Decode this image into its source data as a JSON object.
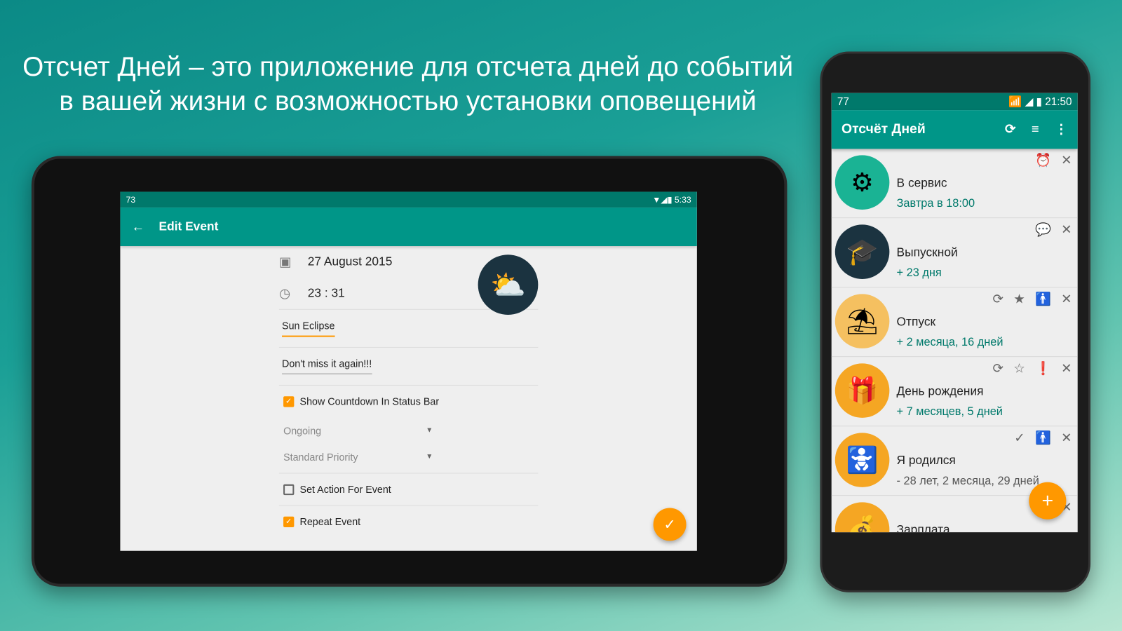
{
  "headline": [
    "Отсчет Дней – это приложение для отсчета дней до событий",
    "в вашей жизни с возможностью установки оповещений"
  ],
  "tablet": {
    "status": {
      "notif": "73",
      "time": "5:33"
    },
    "toolbar": {
      "title": "Edit Event",
      "back_icon": "arrow-left-icon"
    },
    "date": "27 August 2015",
    "time": "23 : 31",
    "title_value": "Sun Eclipse",
    "note_value": "Don't miss it again!!!",
    "show_countdown": {
      "label": "Show Countdown In Status Bar",
      "checked": true
    },
    "ongoing": "Ongoing",
    "priority": "Standard Priority",
    "set_action": {
      "label": "Set Action For Event",
      "checked": false
    },
    "repeat": {
      "label": "Repeat Event",
      "checked": true
    },
    "fab_icon": "check-icon"
  },
  "phone": {
    "status": {
      "notif": "77",
      "time": "21:50"
    },
    "toolbar": {
      "title": "Отсчёт Дней"
    },
    "items": [
      {
        "name": "В сервис",
        "sub": "Завтра в 18:00",
        "icon": "⚙",
        "bg": "#1ab394",
        "actions": [
          "⏰",
          "✕"
        ]
      },
      {
        "name": "Выпускной",
        "sub": "+ 23 дня",
        "icon": "🎓",
        "bg": "#1b3340",
        "actions": [
          "💬",
          "✕"
        ]
      },
      {
        "name": "Отпуск",
        "sub": "+ 2 месяца, 16 дней",
        "icon": "⛱",
        "bg": "#f5c060",
        "actions": [
          "⟳",
          "★",
          "🚹",
          "✕"
        ]
      },
      {
        "name": "День рождения",
        "sub": "+ 7 месяцев, 5 дней",
        "icon": "🎁",
        "bg": "#f5a623",
        "actions": [
          "⟳",
          "☆",
          "❗",
          "✕"
        ]
      },
      {
        "name": "Я родился",
        "sub": "- 28 лет, 2 месяца, 29 дней",
        "icon": "🚼",
        "bg": "#f5a623",
        "actions": [
          "✓",
          "🚹",
          "✕"
        ],
        "neg": true
      },
      {
        "name": "Зарплата",
        "sub": "",
        "icon": "💰",
        "bg": "#f5a623",
        "actions": [
          "⟳",
          "✕"
        ]
      }
    ],
    "fab": "+"
  },
  "colors": {
    "primary": "#009688",
    "primary_dark": "#00796b",
    "accent": "#ff9800"
  }
}
